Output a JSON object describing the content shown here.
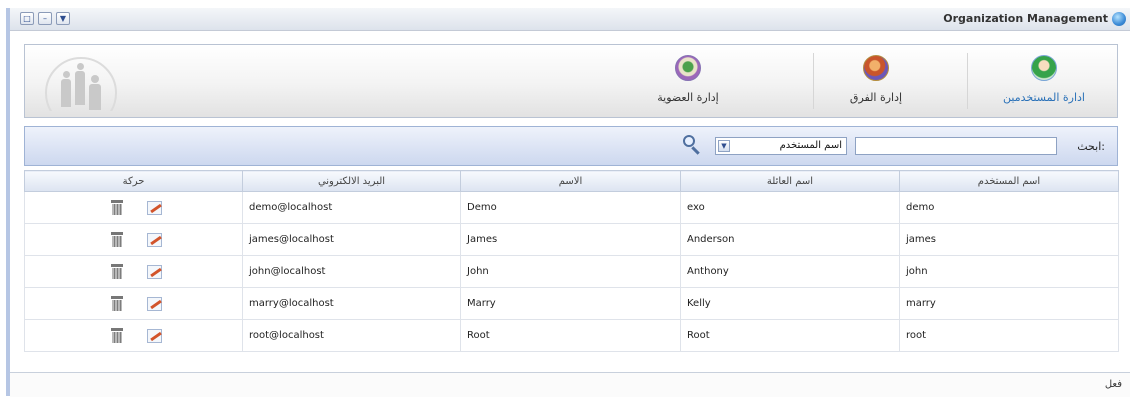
{
  "window": {
    "title": "Organization Management",
    "buttons": [
      "restore",
      "minimize",
      "menu"
    ]
  },
  "tabs": [
    {
      "label": "ادارة المستخدمين",
      "icon": "user-icon",
      "active": true
    },
    {
      "label": "إدارة الفرق",
      "icon": "groups-icon",
      "active": false
    },
    {
      "label": "إدارة العضوية",
      "icon": "membership-icon",
      "active": false
    }
  ],
  "search": {
    "label": "ابحث:",
    "value": "",
    "select_value": "اسم المستخدم"
  },
  "table": {
    "columns": [
      "اسم المستخدم",
      "اسم العائلة",
      "الاسم",
      "البريد الالكتروني",
      "حركة"
    ],
    "rows": [
      {
        "username": "demo",
        "last_name": "exo",
        "first_name": "Demo",
        "email": "demo@localhost"
      },
      {
        "username": "james",
        "last_name": "Anderson",
        "first_name": "James",
        "email": "james@localhost"
      },
      {
        "username": "john",
        "last_name": "Anthony",
        "first_name": "John",
        "email": "john@localhost"
      },
      {
        "username": "marry",
        "last_name": "Kelly",
        "first_name": "Marry",
        "email": "marry@localhost"
      },
      {
        "username": "root",
        "last_name": "Root",
        "first_name": "Root",
        "email": "root@localhost"
      }
    ]
  },
  "status": {
    "text": "فعل"
  },
  "colors": {
    "active_tab": "#2a71b8",
    "search_bar": "#cdd8ef",
    "border_accent": "#b6c6e4"
  }
}
